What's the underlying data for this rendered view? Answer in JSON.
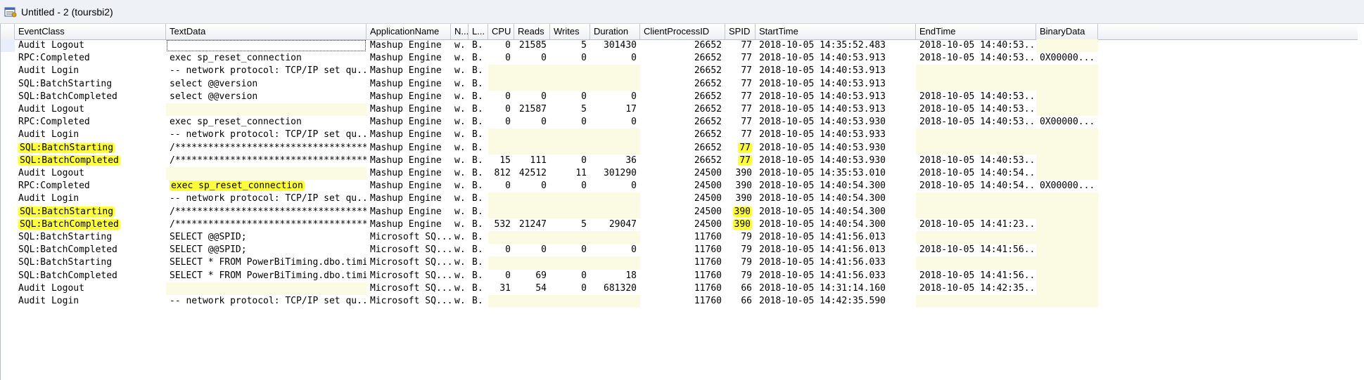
{
  "window": {
    "title": "Untitled - 2 (toursbi2)",
    "icon": "profiler-trace-icon"
  },
  "columns": [
    {
      "key": "event",
      "label": "EventClass"
    },
    {
      "key": "text",
      "label": "TextData"
    },
    {
      "key": "app",
      "label": "ApplicationName"
    },
    {
      "key": "n",
      "label": "N..."
    },
    {
      "key": "l",
      "label": "L..."
    },
    {
      "key": "cpu",
      "label": "CPU"
    },
    {
      "key": "reads",
      "label": "Reads"
    },
    {
      "key": "writes",
      "label": "Writes"
    },
    {
      "key": "duration",
      "label": "Duration"
    },
    {
      "key": "cpid",
      "label": "ClientProcessID"
    },
    {
      "key": "spid",
      "label": "SPID"
    },
    {
      "key": "start",
      "label": "StartTime"
    },
    {
      "key": "end",
      "label": "EndTime"
    },
    {
      "key": "binary",
      "label": "BinaryData"
    }
  ],
  "highlight_color": "#ffff3a",
  "empty_cell_color": "#fbfbe3",
  "rows": [
    {
      "selected": true,
      "event": "Audit Logout",
      "text": "",
      "app": "Mashup Engine",
      "n": "w.",
      "l": "B.",
      "cpu": "0",
      "reads": "21585",
      "writes": "5",
      "duration": "301430",
      "cpid": "26652",
      "spid": "77",
      "start": "2018-10-05 14:35:52.483",
      "end": "2018-10-05 14:40:53...",
      "binary": ""
    },
    {
      "event": "RPC:Completed",
      "text": "exec sp_reset_connection",
      "app": "Mashup Engine",
      "n": "w.",
      "l": "B.",
      "cpu": "0",
      "reads": "0",
      "writes": "0",
      "duration": "0",
      "cpid": "26652",
      "spid": "77",
      "start": "2018-10-05 14:40:53.913",
      "end": "2018-10-05 14:40:53...",
      "binary": "0X00000..."
    },
    {
      "event": "Audit Login",
      "text": "-- network protocol: TCP/IP  set qu...",
      "app": "Mashup Engine",
      "n": "w.",
      "l": "B.",
      "cpu": "",
      "reads": "",
      "writes": "",
      "duration": "",
      "cpid": "26652",
      "spid": "77",
      "start": "2018-10-05 14:40:53.913",
      "end": "",
      "binary": ""
    },
    {
      "event": "SQL:BatchStarting",
      "text": "select @@version",
      "app": "Mashup Engine",
      "n": "w.",
      "l": "B.",
      "cpu": "",
      "reads": "",
      "writes": "",
      "duration": "",
      "cpid": "26652",
      "spid": "77",
      "start": "2018-10-05 14:40:53.913",
      "end": "",
      "binary": ""
    },
    {
      "event": "SQL:BatchCompleted",
      "text": "select @@version",
      "app": "Mashup Engine",
      "n": "w.",
      "l": "B.",
      "cpu": "0",
      "reads": "0",
      "writes": "0",
      "duration": "0",
      "cpid": "26652",
      "spid": "77",
      "start": "2018-10-05 14:40:53.913",
      "end": "2018-10-05 14:40:53...",
      "binary": ""
    },
    {
      "event": "Audit Logout",
      "text": "",
      "app": "Mashup Engine",
      "n": "w.",
      "l": "B.",
      "cpu": "0",
      "reads": "21587",
      "writes": "5",
      "duration": "17",
      "cpid": "26652",
      "spid": "77",
      "start": "2018-10-05 14:40:53.913",
      "end": "2018-10-05 14:40:53...",
      "binary": ""
    },
    {
      "event": "RPC:Completed",
      "text": "exec sp_reset_connection",
      "app": "Mashup Engine",
      "n": "w.",
      "l": "B.",
      "cpu": "0",
      "reads": "0",
      "writes": "0",
      "duration": "0",
      "cpid": "26652",
      "spid": "77",
      "start": "2018-10-05 14:40:53.930",
      "end": "2018-10-05 14:40:53...",
      "binary": "0X00000..."
    },
    {
      "event": "Audit Login",
      "text": "-- network protocol: TCP/IP  set qu...",
      "app": "Mashup Engine",
      "n": "w.",
      "l": "B.",
      "cpu": "",
      "reads": "",
      "writes": "",
      "duration": "",
      "cpid": "26652",
      "spid": "77",
      "start": "2018-10-05 14:40:53.933",
      "end": "",
      "binary": ""
    },
    {
      "event": "SQL:BatchStarting",
      "hl_event": true,
      "text": "/*************************************...",
      "app": "Mashup Engine",
      "n": "w.",
      "l": "B.",
      "cpu": "",
      "reads": "",
      "writes": "",
      "duration": "",
      "cpid": "26652",
      "spid": "77",
      "hl_spid": true,
      "start": "2018-10-05 14:40:53.930",
      "end": "",
      "binary": ""
    },
    {
      "event": "SQL:BatchCompleted",
      "hl_event": true,
      "text": "/*************************************...",
      "app": "Mashup Engine",
      "n": "w.",
      "l": "B.",
      "cpu": "15",
      "reads": "111",
      "writes": "0",
      "duration": "36",
      "cpid": "26652",
      "spid": "77",
      "hl_spid": true,
      "start": "2018-10-05 14:40:53.930",
      "end": "2018-10-05 14:40:53...",
      "binary": ""
    },
    {
      "event": "Audit Logout",
      "text": "",
      "app": "Mashup Engine",
      "n": "w.",
      "l": "B.",
      "cpu": "812",
      "reads": "42512",
      "writes": "11",
      "duration": "301290",
      "cpid": "24500",
      "spid": "390",
      "start": "2018-10-05 14:35:53.010",
      "end": "2018-10-05 14:40:54...",
      "binary": ""
    },
    {
      "event": "RPC:Completed",
      "text": "exec sp_reset_connection",
      "hl_text": true,
      "app": "Mashup Engine",
      "n": "w.",
      "l": "B.",
      "cpu": "0",
      "reads": "0",
      "writes": "0",
      "duration": "0",
      "cpid": "24500",
      "spid": "390",
      "start": "2018-10-05 14:40:54.300",
      "end": "2018-10-05 14:40:54...",
      "binary": "0X00000..."
    },
    {
      "event": "Audit Login",
      "text": "-- network protocol: TCP/IP  set qu...",
      "app": "Mashup Engine",
      "n": "w.",
      "l": "B.",
      "cpu": "",
      "reads": "",
      "writes": "",
      "duration": "",
      "cpid": "24500",
      "spid": "390",
      "start": "2018-10-05 14:40:54.300",
      "end": "",
      "binary": ""
    },
    {
      "event": "SQL:BatchStarting",
      "hl_event": true,
      "text": "/*************************************...",
      "app": "Mashup Engine",
      "n": "w.",
      "l": "B.",
      "cpu": "",
      "reads": "",
      "writes": "",
      "duration": "",
      "cpid": "24500",
      "spid": "390",
      "hl_spid": true,
      "start": "2018-10-05 14:40:54.300",
      "end": "",
      "binary": ""
    },
    {
      "event": "SQL:BatchCompleted",
      "hl_event": true,
      "text": "/*************************************...",
      "app": "Mashup Engine",
      "n": "w.",
      "l": "B.",
      "cpu": "532",
      "reads": "21247",
      "writes": "5",
      "duration": "29047",
      "cpid": "24500",
      "spid": "390",
      "hl_spid": true,
      "start": "2018-10-05 14:40:54.300",
      "end": "2018-10-05 14:41:23...",
      "binary": ""
    },
    {
      "event": "SQL:BatchStarting",
      "text": "SELECT @@SPID;",
      "app": "Microsoft SQ...",
      "n": "w.",
      "l": "B.",
      "cpu": "",
      "reads": "",
      "writes": "",
      "duration": "",
      "cpid": "11760",
      "spid": "79",
      "start": "2018-10-05 14:41:56.013",
      "end": "",
      "binary": ""
    },
    {
      "event": "SQL:BatchCompleted",
      "text": "SELECT @@SPID;",
      "app": "Microsoft SQ...",
      "n": "w.",
      "l": "B.",
      "cpu": "0",
      "reads": "0",
      "writes": "0",
      "duration": "0",
      "cpid": "11760",
      "spid": "79",
      "start": "2018-10-05 14:41:56.013",
      "end": "2018-10-05 14:41:56...",
      "binary": ""
    },
    {
      "event": "SQL:BatchStarting",
      "text": "SELECT * FROM PowerBiTiming.dbo.timing",
      "app": "Microsoft SQ...",
      "n": "w.",
      "l": "B.",
      "cpu": "",
      "reads": "",
      "writes": "",
      "duration": "",
      "cpid": "11760",
      "spid": "79",
      "start": "2018-10-05 14:41:56.033",
      "end": "",
      "binary": ""
    },
    {
      "event": "SQL:BatchCompleted",
      "text": "SELECT * FROM PowerBiTiming.dbo.timing",
      "app": "Microsoft SQ...",
      "n": "w.",
      "l": "B.",
      "cpu": "0",
      "reads": "69",
      "writes": "0",
      "duration": "18",
      "cpid": "11760",
      "spid": "79",
      "start": "2018-10-05 14:41:56.033",
      "end": "2018-10-05 14:41:56...",
      "binary": ""
    },
    {
      "event": "Audit Logout",
      "text": "",
      "app": "Microsoft SQ...",
      "n": "w.",
      "l": "B.",
      "cpu": "31",
      "reads": "54",
      "writes": "0",
      "duration": "681320",
      "cpid": "11760",
      "spid": "66",
      "start": "2018-10-05 14:31:14.160",
      "end": "2018-10-05 14:42:35...",
      "binary": ""
    },
    {
      "event": "Audit Login",
      "text": "-- network protocol: TCP/IP  set qu...",
      "app": "Microsoft SQ...",
      "n": "w.",
      "l": "B.",
      "cpu": "",
      "reads": "",
      "writes": "",
      "duration": "",
      "cpid": "11760",
      "spid": "66",
      "start": "2018-10-05 14:42:35.590",
      "end": "",
      "binary": ""
    }
  ]
}
